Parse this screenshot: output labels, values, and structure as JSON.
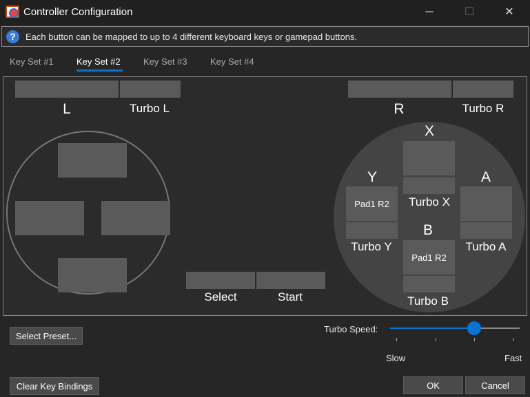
{
  "window": {
    "title": "Controller Configuration",
    "minimize": "─",
    "maximize": "☐",
    "close": "✕"
  },
  "info": {
    "icon": "question-icon",
    "text": "Each button can be mapped to up to 4 different keyboard keys or gamepad buttons."
  },
  "tabs": [
    {
      "label": "Key Set #1"
    },
    {
      "label": "Key Set #2",
      "active": true
    },
    {
      "label": "Key Set #3"
    },
    {
      "label": "Key Set #4"
    }
  ],
  "buttons": {
    "L": {
      "label": "L",
      "value": ""
    },
    "TurboL": {
      "label": "Turbo L",
      "value": ""
    },
    "R": {
      "label": "R",
      "value": ""
    },
    "TurboR": {
      "label": "Turbo R",
      "value": ""
    },
    "Up": {
      "value": ""
    },
    "Left": {
      "value": ""
    },
    "Right": {
      "value": ""
    },
    "Down": {
      "value": ""
    },
    "Select": {
      "label": "Select",
      "value": ""
    },
    "Start": {
      "label": "Start",
      "value": ""
    },
    "X": {
      "label": "X",
      "value": ""
    },
    "TurboX": {
      "label": "Turbo X",
      "value": ""
    },
    "Y": {
      "label": "Y",
      "value": "Pad1 R2"
    },
    "TurboY": {
      "label": "Turbo Y",
      "value": ""
    },
    "A": {
      "label": "A",
      "value": ""
    },
    "TurboA": {
      "label": "Turbo A",
      "value": ""
    },
    "B": {
      "label": "B",
      "value": "Pad1 R2"
    },
    "TurboB": {
      "label": "Turbo B",
      "value": ""
    }
  },
  "turbo": {
    "label": "Turbo Speed:",
    "min_label": "Slow",
    "max_label": "Fast",
    "value": 2,
    "min": 0,
    "max": 3,
    "accent": "#0a74d4"
  },
  "footer": {
    "select_preset": "Select Preset...",
    "clear": "Clear Key Bindings",
    "ok": "OK",
    "cancel": "Cancel"
  }
}
